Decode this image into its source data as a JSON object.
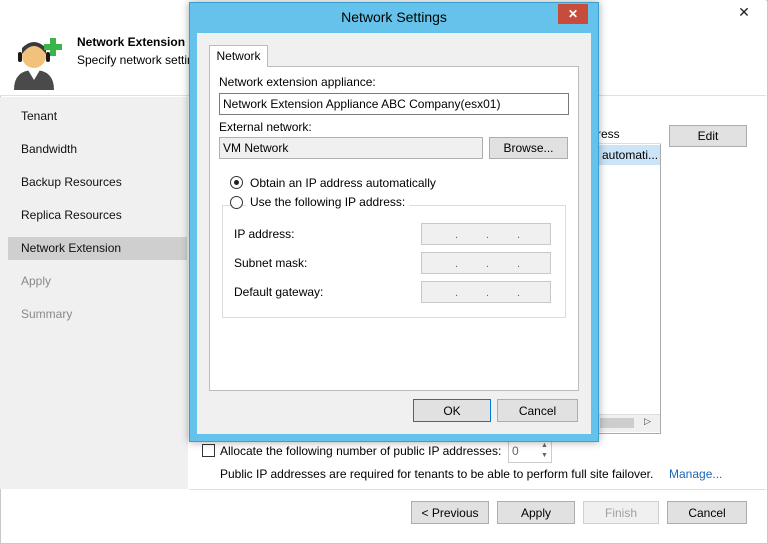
{
  "wizard": {
    "close_glyph": "✕",
    "title": "Network Extension",
    "subtitle": "Specify network settin",
    "nav": [
      {
        "label": "Tenant",
        "state": "normal"
      },
      {
        "label": "Bandwidth",
        "state": "normal"
      },
      {
        "label": "Backup Resources",
        "state": "normal"
      },
      {
        "label": "Replica Resources",
        "state": "normal"
      },
      {
        "label": "Network Extension",
        "state": "active"
      },
      {
        "label": "Apply",
        "state": "disabled"
      },
      {
        "label": "Summary",
        "state": "disabled"
      }
    ],
    "table": {
      "header_fragment": "ress",
      "row_fragment": "automati..."
    },
    "edit_label": "Edit",
    "allocate_label": "Allocate the following number of public IP addresses:",
    "allocate_checked": false,
    "allocate_value": "0",
    "failover_text": "Public IP addresses are required for tenants to be able to perform full site failover.",
    "manage_label": "Manage...",
    "buttons": {
      "previous": "< Previous",
      "apply": "Apply",
      "finish": "Finish",
      "cancel": "Cancel"
    }
  },
  "modal": {
    "title": "Network Settings",
    "close_glyph": "✕",
    "tab_label": "Network",
    "appliance_label": "Network extension appliance:",
    "appliance_value": "Network Extension Appliance ABC Company(esx01)",
    "external_network_label": "External network:",
    "external_network_value": "VM Network",
    "browse_label": "Browse...",
    "radio_auto_label": "Obtain an IP address automatically",
    "radio_manual_label": "Use the following IP address:",
    "selected_option": "auto",
    "ip_fields": [
      {
        "label": "IP address:"
      },
      {
        "label": "Subnet mask:"
      },
      {
        "label": "Default gateway:"
      }
    ],
    "ip_separator": ".",
    "ok_label": "OK",
    "cancel_label": "Cancel"
  },
  "colors": {
    "modal_frame": "#65c3eb",
    "close_button": "#c74c3c",
    "nav_active": "#cfcfcf",
    "link": "#1a66b5",
    "selected_row": "#cce4f7"
  }
}
